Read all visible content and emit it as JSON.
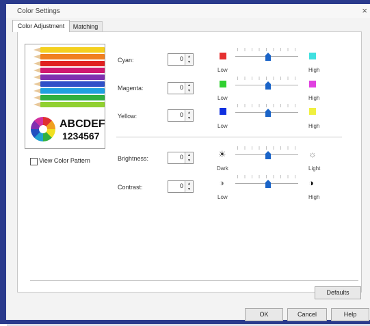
{
  "window": {
    "title": "Color Settings",
    "close_label": "×"
  },
  "tabs": [
    {
      "label": "Color Adjustment",
      "active": true
    },
    {
      "label": "Matching",
      "active": false
    }
  ],
  "preview": {
    "text_line1": "ABCDEF",
    "text_line2": "1234567"
  },
  "view_color_pattern": {
    "label": "View Color Pattern",
    "checked": false
  },
  "adjustments": [
    {
      "label": "Cyan:",
      "value": "0",
      "low_label": "Low",
      "high_label": "High",
      "low_color": "#e53030",
      "high_color": "#40e0e0",
      "slider_level": 0.5
    },
    {
      "label": "Magenta:",
      "value": "0",
      "low_label": "Low",
      "high_label": "High",
      "low_color": "#30d030",
      "high_color": "#e040e0",
      "slider_level": 0.5
    },
    {
      "label": "Yellow:",
      "value": "0",
      "low_label": "Low",
      "high_label": "High",
      "low_color": "#1030e0",
      "high_color": "#f0f040",
      "slider_level": 0.5
    },
    {
      "label": "Brightness:",
      "value": "0",
      "low_label": "Dark",
      "high_label": "Light",
      "low_icon": "sun-dark-icon",
      "high_icon": "sun-light-icon",
      "slider_level": 0.5
    },
    {
      "label": "Contrast:",
      "value": "0",
      "low_label": "Low",
      "high_label": "High",
      "low_icon": "contrast-low-icon",
      "high_icon": "contrast-high-icon",
      "slider_level": 0.5
    }
  ],
  "buttons": {
    "defaults": "Defaults",
    "ok": "OK",
    "cancel": "Cancel",
    "help": "Help"
  },
  "colors": {
    "frame": "#2a3a8c",
    "slider_thumb": "#1a64c8"
  }
}
